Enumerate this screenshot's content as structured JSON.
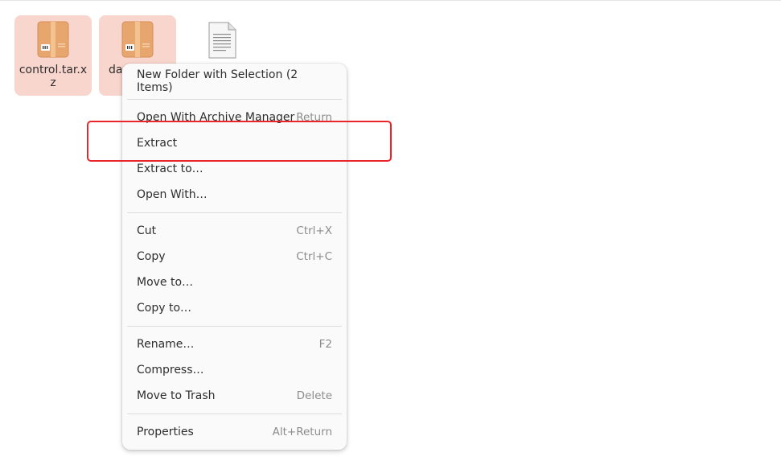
{
  "files": [
    {
      "name": "control.tar.xz",
      "label_line1": "control.tar.x",
      "label_line2": "z",
      "type": "archive",
      "selected": true,
      "icon": "archive-box-icon"
    },
    {
      "name": "data",
      "label_visible": "da",
      "type": "archive",
      "selected": true,
      "icon": "archive-box-icon"
    },
    {
      "name": "",
      "type": "document",
      "selected": false,
      "icon": "text-document-icon"
    }
  ],
  "context_menu": {
    "sections": [
      [
        {
          "label": "New Folder with Selection (2 Items)",
          "shortcut": ""
        }
      ],
      [
        {
          "label": "Open With Archive Manager",
          "shortcut": "Return"
        },
        {
          "label": "Extract",
          "shortcut": ""
        },
        {
          "label": "Extract to…",
          "shortcut": ""
        },
        {
          "label": "Open With…",
          "shortcut": ""
        }
      ],
      [
        {
          "label": "Cut",
          "shortcut": "Ctrl+X"
        },
        {
          "label": "Copy",
          "shortcut": "Ctrl+C"
        },
        {
          "label": "Move to…",
          "shortcut": ""
        },
        {
          "label": "Copy to…",
          "shortcut": ""
        }
      ],
      [
        {
          "label": "Rename…",
          "shortcut": "F2"
        },
        {
          "label": "Compress…",
          "shortcut": ""
        },
        {
          "label": "Move to Trash",
          "shortcut": "Delete"
        }
      ],
      [
        {
          "label": "Properties",
          "shortcut": "Alt+Return"
        }
      ]
    ]
  },
  "colors": {
    "selection_bg": "#f9d6cd",
    "archive_orange": "#e8a66f",
    "highlight_red": "#e8262b"
  }
}
